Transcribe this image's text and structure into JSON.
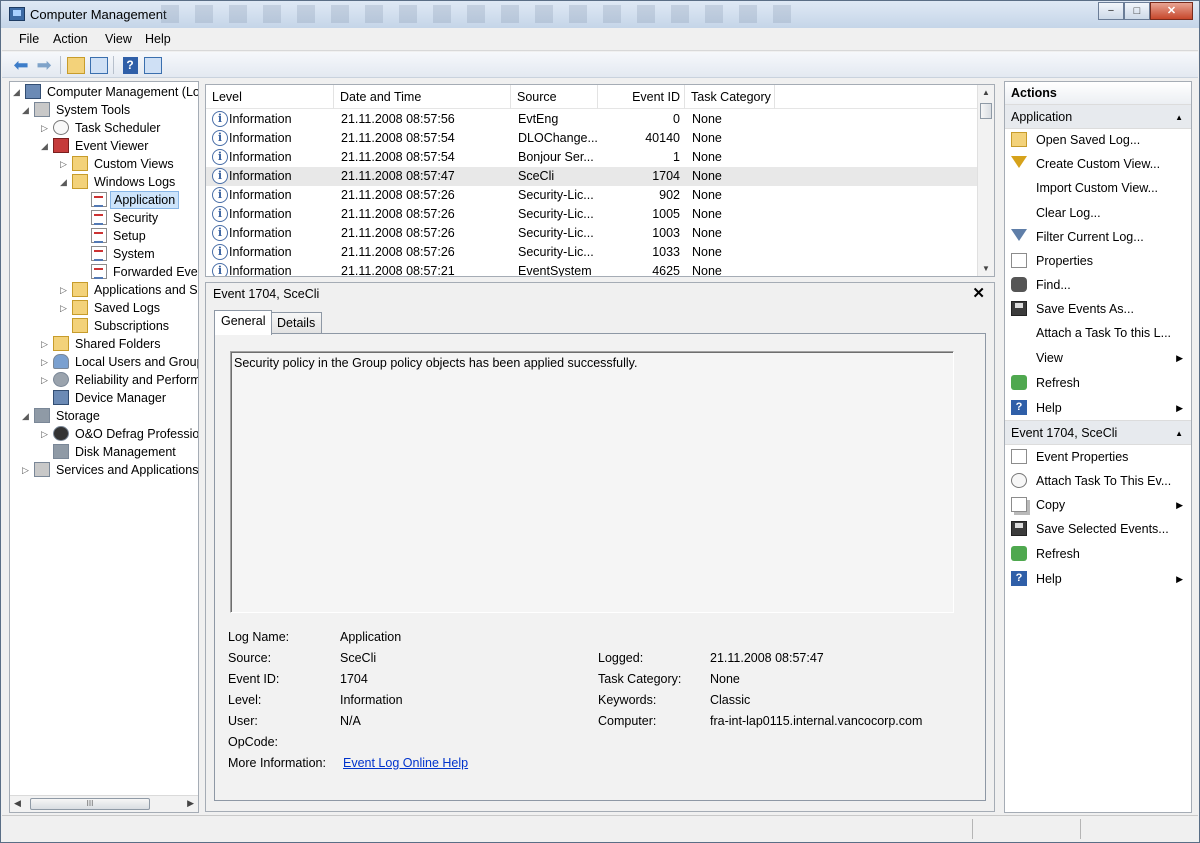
{
  "window": {
    "title": "Computer Management",
    "minimize_label": "−",
    "maximize_label": "□",
    "close_label": "✕"
  },
  "menu": [
    "File",
    "Action",
    "View",
    "Help"
  ],
  "toolbar": {
    "icons": [
      "back-arrow-icon",
      "forward-arrow-icon",
      "up-folder-icon",
      "show-hide-console-tree-icon",
      "help-icon",
      "show-hide-action-pane-icon"
    ]
  },
  "tree": {
    "items": [
      {
        "label": "Computer Management (Local",
        "icon": "computer-management-icon",
        "expander": "◢"
      },
      {
        "label": "System Tools",
        "icon": "system-tools-icon",
        "expander": "◢"
      },
      {
        "label": "Task Scheduler",
        "icon": "clock-icon",
        "expander": "▷"
      },
      {
        "label": "Event Viewer",
        "icon": "event-viewer-icon",
        "expander": "◢"
      },
      {
        "label": "Custom Views",
        "icon": "folder-icon",
        "expander": "▷"
      },
      {
        "label": "Windows Logs",
        "icon": "folder-icon",
        "expander": "◢"
      },
      {
        "label": "Application",
        "icon": "log-icon",
        "expander": ""
      },
      {
        "label": "Security",
        "icon": "log-icon",
        "expander": ""
      },
      {
        "label": "Setup",
        "icon": "log-icon",
        "expander": ""
      },
      {
        "label": "System",
        "icon": "log-icon",
        "expander": ""
      },
      {
        "label": "Forwarded Event",
        "icon": "log-icon",
        "expander": ""
      },
      {
        "label": "Applications and Se",
        "icon": "folder-icon",
        "expander": "▷"
      },
      {
        "label": "Saved Logs",
        "icon": "folder-icon",
        "expander": "▷"
      },
      {
        "label": "Subscriptions",
        "icon": "folder-icon",
        "expander": ""
      },
      {
        "label": "Shared Folders",
        "icon": "shared-folder-icon",
        "expander": "▷"
      },
      {
        "label": "Local Users and Groups",
        "icon": "users-icon",
        "expander": "▷"
      },
      {
        "label": "Reliability and Performa",
        "icon": "performance-icon",
        "expander": "▷"
      },
      {
        "label": "Device Manager",
        "icon": "device-manager-icon",
        "expander": ""
      },
      {
        "label": "Storage",
        "icon": "storage-icon",
        "expander": "◢"
      },
      {
        "label": "O&O Defrag Profession",
        "icon": "defrag-icon",
        "expander": "▷"
      },
      {
        "label": "Disk Management",
        "icon": "disk-icon",
        "expander": ""
      },
      {
        "label": "Services and Applications",
        "icon": "services-icon",
        "expander": "▷"
      }
    ],
    "scroll_grip": "III"
  },
  "events": {
    "columns": [
      "Level",
      "Date and Time",
      "Source",
      "Event ID",
      "Task Category"
    ],
    "rows": [
      {
        "level": "Information",
        "datetime": "21.11.2008 08:57:56",
        "source": "EvtEng",
        "event_id": "0",
        "category": "None"
      },
      {
        "level": "Information",
        "datetime": "21.11.2008 08:57:54",
        "source": "DLOChange...",
        "event_id": "40140",
        "category": "None"
      },
      {
        "level": "Information",
        "datetime": "21.11.2008 08:57:54",
        "source": "Bonjour Ser...",
        "event_id": "1",
        "category": "None"
      },
      {
        "level": "Information",
        "datetime": "21.11.2008 08:57:47",
        "source": "SceCli",
        "event_id": "1704",
        "category": "None"
      },
      {
        "level": "Information",
        "datetime": "21.11.2008 08:57:26",
        "source": "Security-Lic...",
        "event_id": "902",
        "category": "None"
      },
      {
        "level": "Information",
        "datetime": "21.11.2008 08:57:26",
        "source": "Security-Lic...",
        "event_id": "1005",
        "category": "None"
      },
      {
        "level": "Information",
        "datetime": "21.11.2008 08:57:26",
        "source": "Security-Lic...",
        "event_id": "1003",
        "category": "None"
      },
      {
        "level": "Information",
        "datetime": "21.11.2008 08:57:26",
        "source": "Security-Lic...",
        "event_id": "1033",
        "category": "None"
      },
      {
        "level": "Information",
        "datetime": "21.11.2008 08:57:21",
        "source": "EventSystem",
        "event_id": "4625",
        "category": "None"
      }
    ],
    "info_glyph": "i"
  },
  "detail": {
    "title": "Event 1704, SceCli",
    "close_glyph": "✕",
    "tabs": [
      "General",
      "Details"
    ],
    "message": "Security policy in the Group policy objects has been applied successfully.",
    "labels": {
      "log_name": "Log Name:",
      "source": "Source:",
      "event_id": "Event ID:",
      "level": "Level:",
      "user": "User:",
      "opcode": "OpCode:",
      "more_info": "More Information:",
      "logged": "Logged:",
      "task_category": "Task Category:",
      "keywords": "Keywords:",
      "computer": "Computer:"
    },
    "values": {
      "log_name": "Application",
      "source": "SceCli",
      "event_id": "1704",
      "level": "Information",
      "user": "N/A",
      "opcode": "",
      "logged": "21.11.2008 08:57:47",
      "task_category": "None",
      "keywords": "Classic",
      "computer": "fra-int-lap0115.internal.vancocorp.com"
    },
    "help_link": "Event Log Online Help"
  },
  "actions": {
    "header": "Actions",
    "sections": [
      {
        "title": "Application",
        "items": [
          {
            "label": "Open Saved Log...",
            "icon": "open-folder-icon",
            "submenu": false
          },
          {
            "label": "Create Custom View...",
            "icon": "filter-icon",
            "submenu": false
          },
          {
            "label": "Import Custom View...",
            "icon": "",
            "submenu": false
          },
          {
            "label": "Clear Log...",
            "icon": "",
            "submenu": false
          },
          {
            "label": "Filter Current Log...",
            "icon": "filter-icon",
            "submenu": false
          },
          {
            "label": "Properties",
            "icon": "properties-icon",
            "submenu": false
          },
          {
            "label": "Find...",
            "icon": "binoculars-icon",
            "submenu": false
          },
          {
            "label": "Save Events As...",
            "icon": "save-icon",
            "submenu": false
          },
          {
            "label": "Attach a Task To this L...",
            "icon": "",
            "submenu": false
          },
          {
            "label": "View",
            "icon": "",
            "submenu": true
          },
          {
            "label": "Refresh",
            "icon": "refresh-icon",
            "submenu": false
          },
          {
            "label": "Help",
            "icon": "help-icon",
            "submenu": true
          }
        ]
      },
      {
        "title": "Event 1704, SceCli",
        "items": [
          {
            "label": "Event Properties",
            "icon": "properties-icon",
            "submenu": false
          },
          {
            "label": "Attach Task To This Ev...",
            "icon": "task-icon",
            "submenu": false
          },
          {
            "label": "Copy",
            "icon": "copy-icon",
            "submenu": true
          },
          {
            "label": "Save Selected Events...",
            "icon": "save-icon",
            "submenu": false
          },
          {
            "label": "Refresh",
            "icon": "refresh-icon",
            "submenu": false
          },
          {
            "label": "Help",
            "icon": "help-icon",
            "submenu": true
          }
        ]
      }
    ],
    "collapse_glyph": "▲",
    "submenu_glyph": "▶"
  }
}
